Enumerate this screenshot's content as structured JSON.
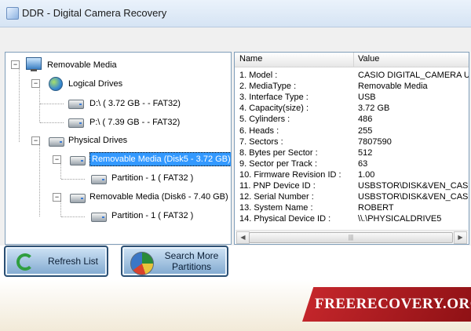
{
  "window": {
    "title": "DDR - Digital Camera Recovery"
  },
  "tree": {
    "root": "Removable Media",
    "logical_drives": "Logical Drives",
    "drive_d": "D:\\ (  3.72 GB -  - FAT32)",
    "drive_p": "P:\\ (  7.39 GB -  - FAT32)",
    "physical_drives": "Physical Drives",
    "disk5": "Removable Media (Disk5 - 3.72 GB)",
    "disk5_partition": "Partition - 1 ( FAT32 )",
    "disk6": "Removable Media (Disk6 - 7.40 GB)",
    "disk6_partition": "Partition - 1 ( FAT32 )",
    "collapse_glyph": "−"
  },
  "properties": {
    "headers": {
      "name": "Name",
      "value": "Value"
    },
    "rows": [
      {
        "name": "1. Model :",
        "value": "CASIO DIGITAL_CAMERA USI"
      },
      {
        "name": "2. MediaType :",
        "value": "Removable Media"
      },
      {
        "name": "3. Interface Type :",
        "value": "USB"
      },
      {
        "name": "4. Capacity(size) :",
        "value": "3.72 GB"
      },
      {
        "name": "5. Cylinders :",
        "value": "486"
      },
      {
        "name": "6. Heads :",
        "value": "255"
      },
      {
        "name": "7. Sectors :",
        "value": "7807590"
      },
      {
        "name": "8. Bytes per Sector :",
        "value": "512"
      },
      {
        "name": "9. Sector per Track :",
        "value": "63"
      },
      {
        "name": "10. Firmware Revision ID :",
        "value": "1.00"
      },
      {
        "name": "11. PNP Device ID :",
        "value": "USBSTOR\\DISK&VEN_CASIO&"
      },
      {
        "name": "12. Serial Number :",
        "value": "USBSTOR\\DISK&VEN_CASIO&"
      },
      {
        "name": "13. System Name :",
        "value": "ROBERT"
      },
      {
        "name": "14. Physical Device ID :",
        "value": "\\\\.\\PHYSICALDRIVE5"
      }
    ],
    "scroll_left": "◀",
    "scroll_right": "▶",
    "scroll_grip": "|||"
  },
  "buttons": {
    "refresh": "Refresh List",
    "search_line1": "Search More",
    "search_line2": "Partitions"
  },
  "footer": {
    "brand": "FREERECOVERY.ORG"
  },
  "colors": {
    "selection": "#3399ff",
    "brand_red": "#b51d22",
    "button_border": "#2b4f73"
  },
  "icons": [
    "removable-media-icon",
    "logical-drives-icon",
    "drive-icon",
    "physical-drives-icon",
    "refresh-icon",
    "search-partitions-icon"
  ]
}
